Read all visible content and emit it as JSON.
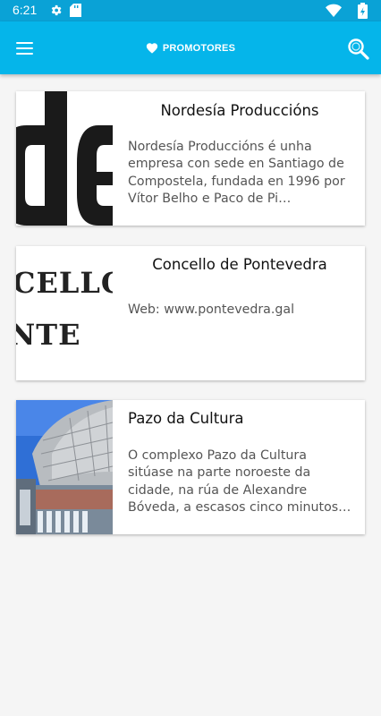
{
  "status_bar": {
    "time": "6:21",
    "icons": [
      "gear-icon",
      "sd-card-icon",
      "wifi-icon",
      "battery-icon"
    ]
  },
  "app_bar": {
    "title": "PROMOTORES",
    "title_icon": "heart-icon",
    "menu_icon": "hamburger-menu-icon",
    "search_icon": "search-icon",
    "background_color": "#05b5ea"
  },
  "promoters": [
    {
      "title": "Nordesía Produccións",
      "description": "Nordesía Produccións é unha empresa con sede en Santiago de Compostela, fundada en 1996 por Vítor Belho e Paco de Pi…"
    },
    {
      "title": "Concello de Pontevedra",
      "description": "Web: www.pontevedra.gal"
    },
    {
      "title": "Pazo da Cultura",
      "description": "O complexo Pazo da Cultura sitúase na parte noroeste da cidade, na rúa de Alexandre Bóveda, a escasos cinco minutos …"
    }
  ]
}
